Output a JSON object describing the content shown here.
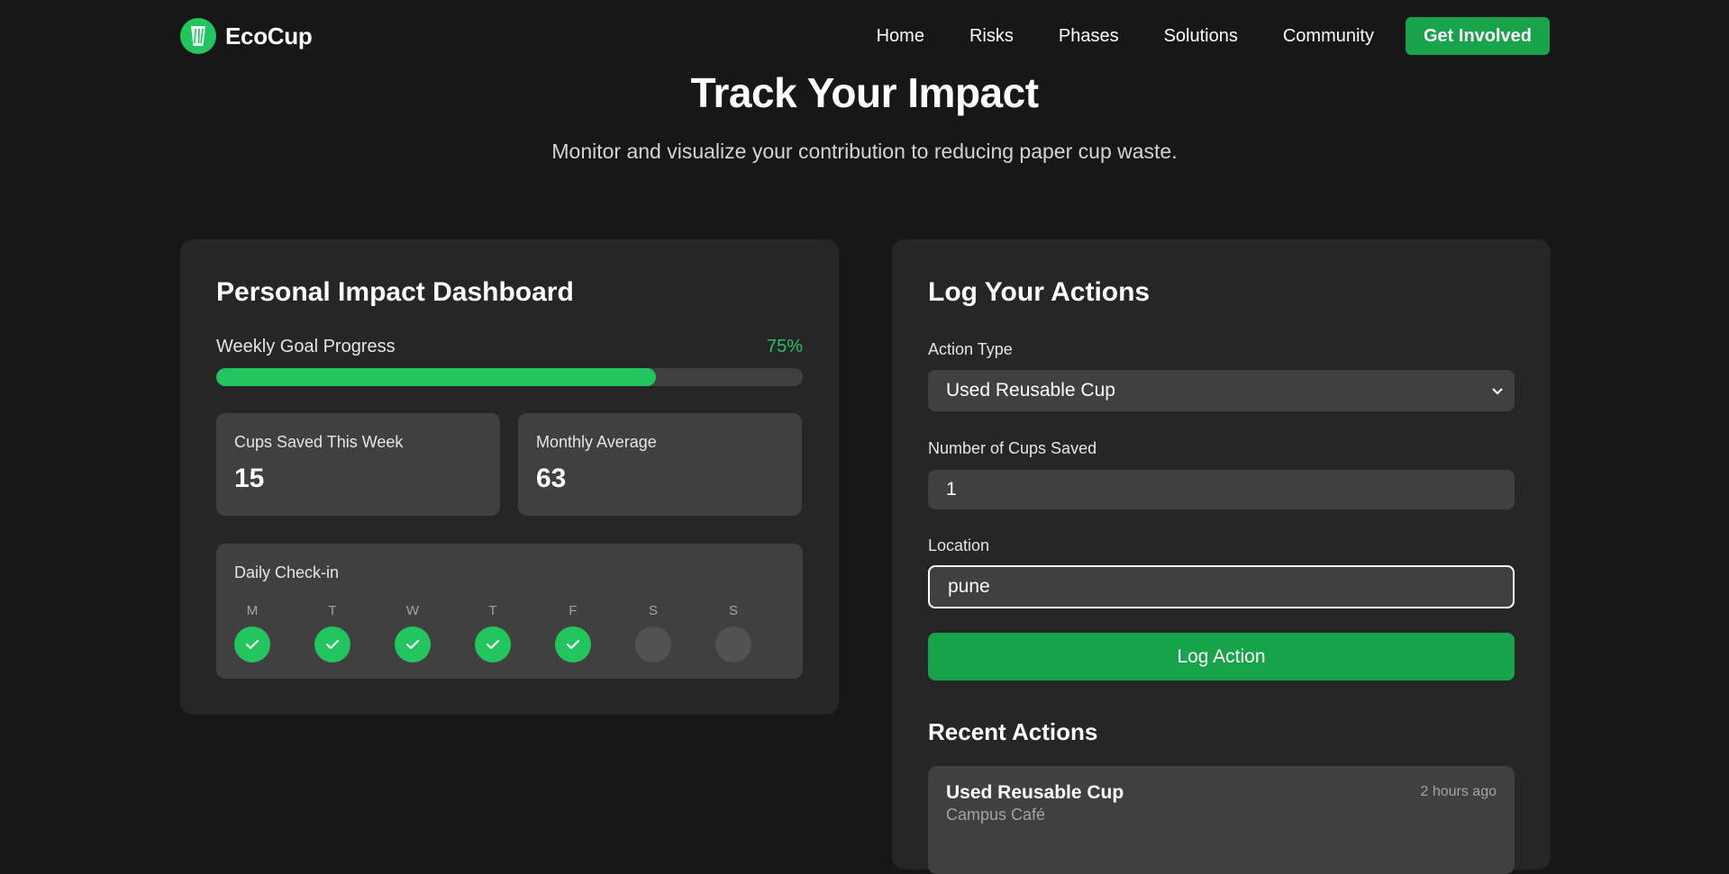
{
  "brand": {
    "name": "EcoCup",
    "icon": "cup-icon",
    "accent": "#22c55e",
    "button_color": "#16a34a"
  },
  "nav": {
    "links": [
      "Home",
      "Risks",
      "Phases",
      "Solutions",
      "Community"
    ],
    "cta": "Get Involved"
  },
  "hero": {
    "title": "Track Your Impact",
    "subtitle": "Monitor and visualize your contribution to reducing paper cup waste."
  },
  "dashboard": {
    "title": "Personal Impact Dashboard",
    "progress": {
      "label": "Weekly Goal Progress",
      "percent_text": "75%",
      "value": 0.75
    },
    "stats": [
      {
        "label": "Cups Saved This Week",
        "value": "15"
      },
      {
        "label": "Monthly Average",
        "value": "63"
      }
    ],
    "checkin": {
      "title": "Daily Check-in",
      "days": [
        {
          "letter": "M",
          "done": true
        },
        {
          "letter": "T",
          "done": true
        },
        {
          "letter": "W",
          "done": true
        },
        {
          "letter": "T",
          "done": true
        },
        {
          "letter": "F",
          "done": true
        },
        {
          "letter": "S",
          "done": false
        },
        {
          "letter": "S",
          "done": false
        }
      ]
    }
  },
  "log": {
    "title": "Log Your Actions",
    "action_type": {
      "label": "Action Type",
      "value": "Used Reusable Cup"
    },
    "cups": {
      "label": "Number of Cups Saved",
      "value": "1"
    },
    "location": {
      "label": "Location",
      "value": "pune"
    },
    "submit": "Log Action",
    "recent": {
      "title": "Recent Actions",
      "items": [
        {
          "name": "Used Reusable Cup",
          "location": "Campus Café",
          "time": "2 hours ago"
        }
      ]
    }
  }
}
